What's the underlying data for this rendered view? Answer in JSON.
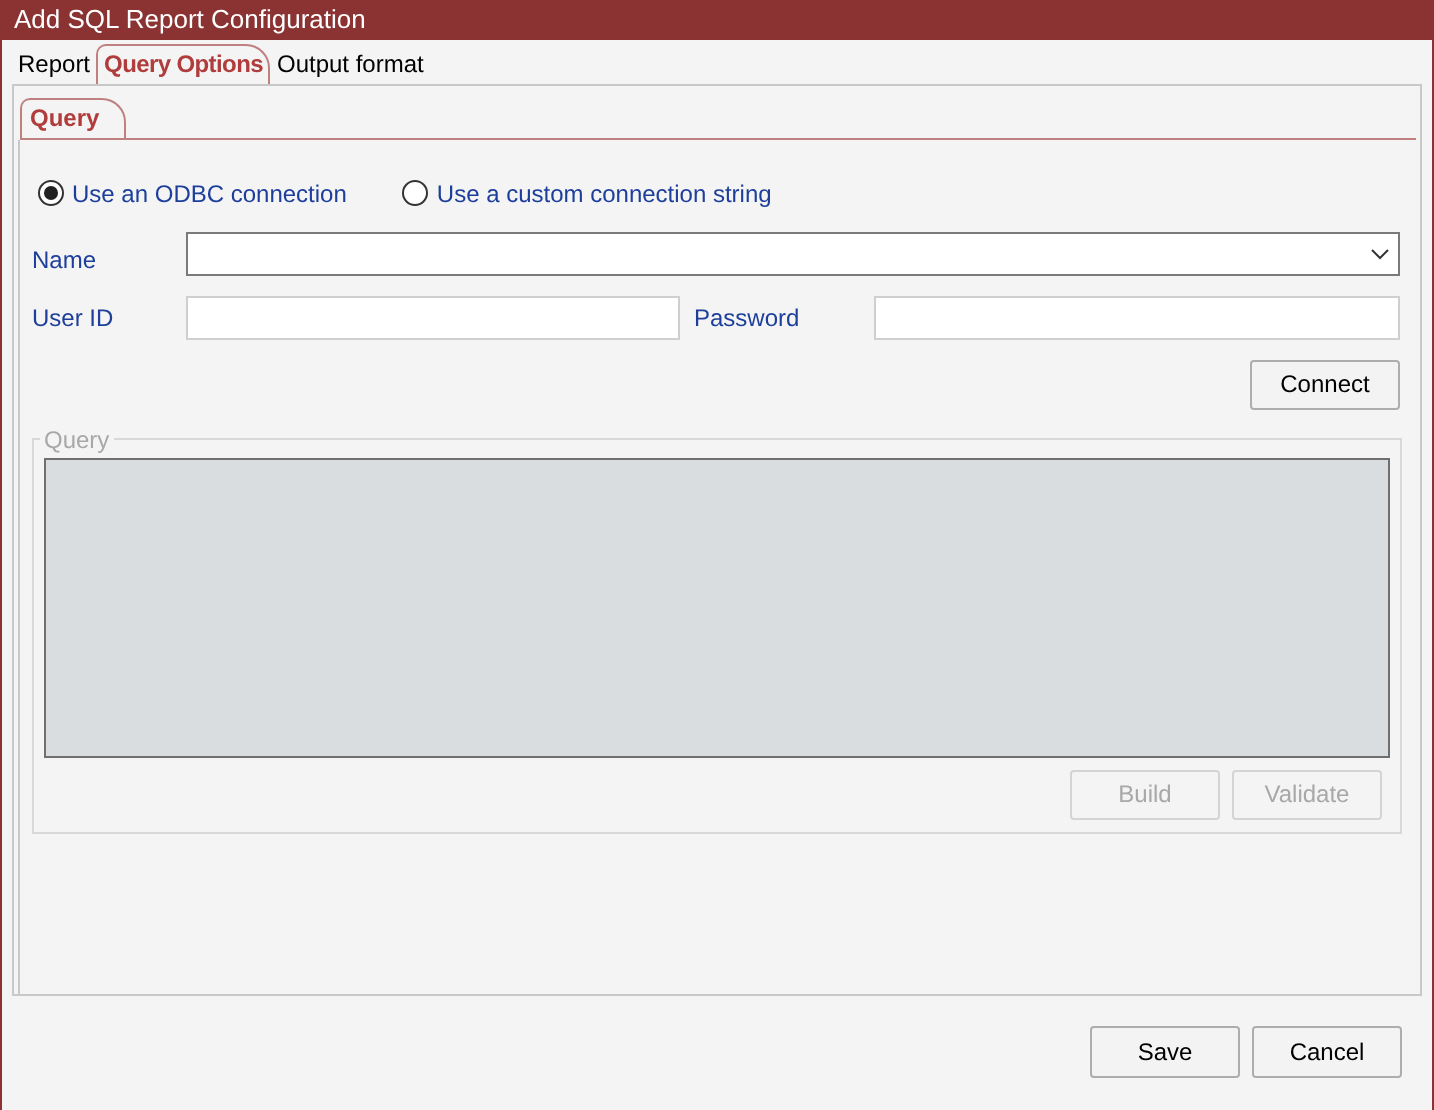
{
  "window": {
    "title": "Add SQL Report Configuration"
  },
  "tabs": [
    {
      "label": "Report",
      "selected": false
    },
    {
      "label": "Query Options",
      "selected": true
    },
    {
      "label": "Output format",
      "selected": false
    }
  ],
  "subtabs": [
    {
      "label": "Query",
      "selected": true
    }
  ],
  "connection_types": [
    {
      "label": "Use an ODBC connection",
      "selected": true
    },
    {
      "label": "Use a custom connection string",
      "selected": false
    }
  ],
  "name_field": {
    "label": "Name"
  },
  "user_id_field": {
    "label": "User ID"
  },
  "password_field": {
    "label": "Password"
  },
  "connect_button": {
    "label": "Connect",
    "disabled": false
  },
  "query_group": {
    "title": "Query",
    "editor_disabled": true,
    "buttons": [
      {
        "label": "Build",
        "disabled": true
      },
      {
        "label": "Validate",
        "disabled": true
      }
    ]
  },
  "footer_buttons": [
    {
      "label": "Save"
    },
    {
      "label": "Cancel"
    }
  ]
}
